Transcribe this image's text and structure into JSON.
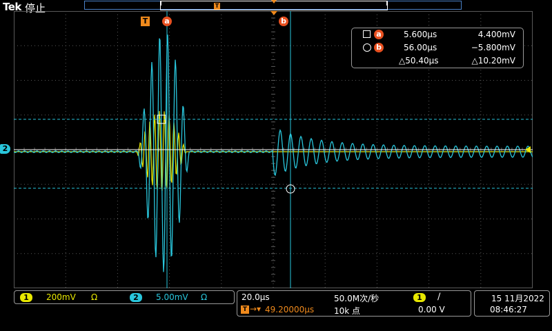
{
  "header": {
    "brand": "Tek",
    "status": "停止"
  },
  "markers": {
    "trigger_label": "T",
    "cursor_a_label": "a",
    "cursor_b_label": "b",
    "ch2_label": "2"
  },
  "cursor_readout": {
    "a_time": "5.600µs",
    "a_value": "4.400mV",
    "b_time": "56.00µs",
    "b_value": "−5.800mV",
    "delta_time": "△50.40µs",
    "delta_value": "△10.20mV"
  },
  "channels": {
    "ch1": {
      "number": "1",
      "scale": "200mV",
      "impedance": "Ω",
      "color": "#e8e800"
    },
    "ch2": {
      "number": "2",
      "scale": "5.00mV",
      "impedance": "Ω",
      "color": "#29c6dc"
    }
  },
  "horizontal": {
    "time_per_div": "20.0µs",
    "sample_rate": "50.0M次/秒",
    "trigger_position": "49.20000µs",
    "record_length": "10k 点"
  },
  "trigger": {
    "source": "1",
    "slope": "∕",
    "level": "0.00 V"
  },
  "datetime": {
    "date": "15 11月2022",
    "time": "08:46:27"
  },
  "colors": {
    "ch1": "#e8e800",
    "ch2": "#29c6dc",
    "trigger": "#f08a1c",
    "cursor": "#e85020",
    "grid": "#5a5a5a"
  }
}
